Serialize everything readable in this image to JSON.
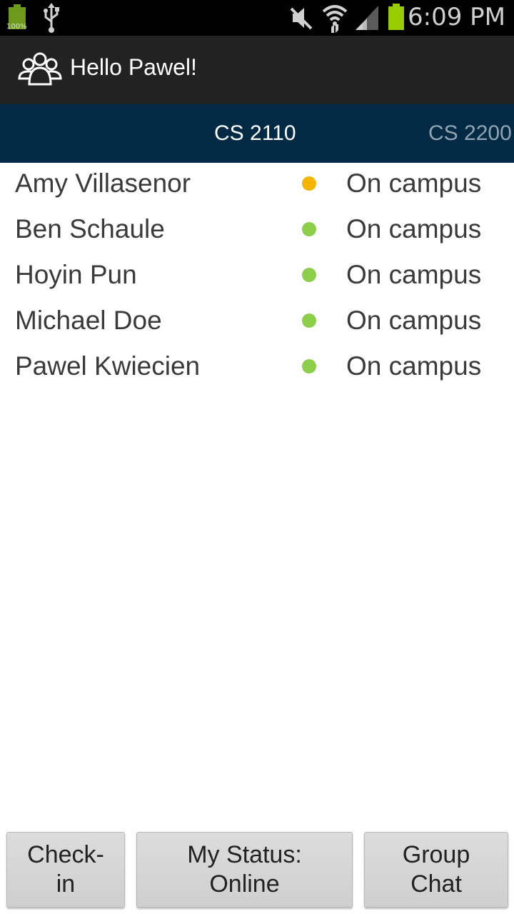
{
  "status_bar": {
    "battery_small_label": "100%",
    "time": "6:09 PM",
    "icons": [
      "battery-full-icon",
      "usb-icon",
      "mute-icon",
      "wifi-icon",
      "signal-icon",
      "battery-icon"
    ]
  },
  "action_bar": {
    "logo_icon": "group-icon",
    "title": "Hello Pawel!"
  },
  "tabs": [
    {
      "label": "CS 2110",
      "active": true
    },
    {
      "label": "CS 2200",
      "active": false
    }
  ],
  "members": [
    {
      "name": "Amy Villasenor",
      "status_color": "#f4b400",
      "location": "On campus"
    },
    {
      "name": "Ben Schaule",
      "status_color": "#8bcf4a",
      "location": "On campus"
    },
    {
      "name": "Hoyin Pun",
      "status_color": "#8bcf4a",
      "location": "On campus"
    },
    {
      "name": "Michael Doe",
      "status_color": "#8bcf4a",
      "location": "On campus"
    },
    {
      "name": "Pawel Kwiecien",
      "status_color": "#8bcf4a",
      "location": "On campus"
    }
  ],
  "buttons": {
    "checkin": {
      "line1": "Check-",
      "line2": "in"
    },
    "my_status": {
      "line1": "My Status:",
      "line2": "Online"
    },
    "group_chat": {
      "line1": "Group",
      "line2": "Chat"
    }
  },
  "colors": {
    "tab_strip": "#022a45",
    "action_bar": "#222222",
    "away": "#f4b400",
    "online": "#8bcf4a"
  }
}
